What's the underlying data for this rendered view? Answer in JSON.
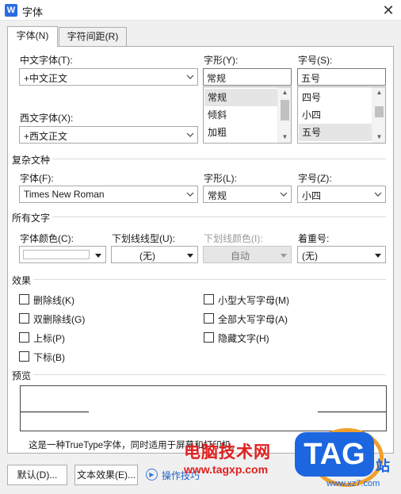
{
  "window": {
    "title": "字体",
    "app_icon_letter": "W",
    "close_glyph": "✕"
  },
  "tabs": [
    {
      "label": "字体(N)",
      "active": true
    },
    {
      "label": "字符间距(R)",
      "active": false
    }
  ],
  "chinese_font": {
    "label": "中文字体(T):",
    "value": "+中文正文"
  },
  "western_font": {
    "label": "西文字体(X):",
    "value": "+西文正文"
  },
  "style": {
    "label": "字形(Y):",
    "value": "常规",
    "options": [
      "常规",
      "倾斜",
      "加粗"
    ],
    "selected": 0
  },
  "size": {
    "label": "字号(S):",
    "value": "五号",
    "options": [
      "四号",
      "小四",
      "五号"
    ],
    "selected": 2
  },
  "complex": {
    "section": "复杂文种",
    "font_label": "字体(F):",
    "font_value": "Times New Roman",
    "style_label": "字形(L):",
    "style_value": "常规",
    "size_label": "字号(Z):",
    "size_value": "小四"
  },
  "all_text": {
    "section": "所有文字",
    "color_label": "字体颜色(C):",
    "underline_label": "下划线线型(U):",
    "underline_value": "(无)",
    "underline_color_label": "下划线颜色(I):",
    "underline_color_value": "自动",
    "emphasis_label": "着重号:",
    "emphasis_value": "(无)"
  },
  "effects": {
    "section": "效果",
    "left": [
      "删除线(K)",
      "双删除线(G)",
      "上标(P)",
      "下标(B)"
    ],
    "right": [
      "小型大写字母(M)",
      "全部大写字母(A)",
      "隐藏文字(H)"
    ]
  },
  "preview": {
    "section": "预览",
    "description": "这是一种TrueType字体，同时适用于屏幕和打印机。"
  },
  "buttons": {
    "default": "默认(D)...",
    "text_effects": "文本效果(E)...",
    "tips": "操作技巧"
  },
  "watermark": {
    "tag": "TAG",
    "cn": "电脑技术网",
    "zhan": "站",
    "url": "www.tagxp.com",
    "url2": "www.xz7.com"
  }
}
